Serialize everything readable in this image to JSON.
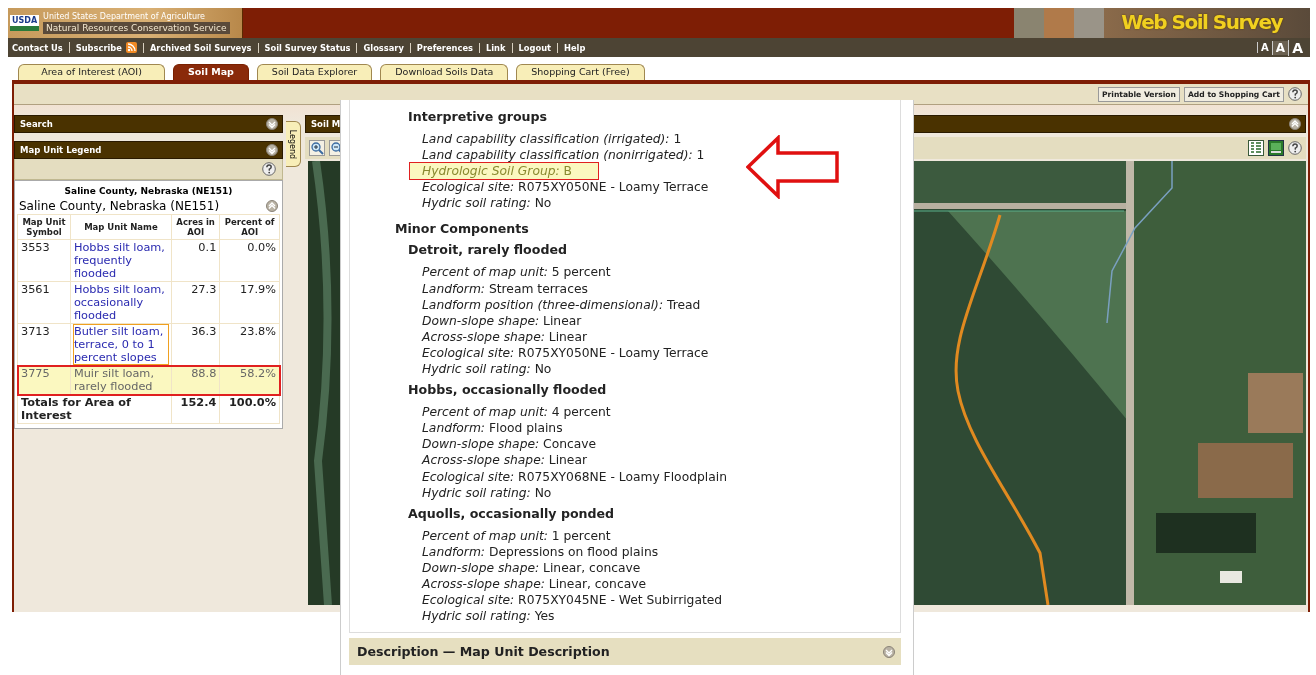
{
  "banner": {
    "logo": "USDA",
    "agency": "United States Department of Agriculture",
    "service": "Natural Resources Conservation Service",
    "site_title": "Web Soil Survey"
  },
  "nav": {
    "links": [
      {
        "label": "Contact Us",
        "kind": "link"
      },
      {
        "label": "Subscribe",
        "kind": "feed"
      },
      {
        "label": "Archived Soil Surveys",
        "kind": "link"
      },
      {
        "label": "Soil Survey Status",
        "kind": "link"
      },
      {
        "label": "Glossary",
        "kind": "link"
      },
      {
        "label": "Preferences",
        "kind": "link"
      },
      {
        "label": "Link",
        "kind": "link"
      },
      {
        "label": "Logout",
        "kind": "link"
      },
      {
        "label": "Help",
        "kind": "link"
      }
    ],
    "font_size_buttons": [
      "A",
      "A",
      "A"
    ]
  },
  "tabs": [
    {
      "label": "Area of Interest (AOI)",
      "selected": false
    },
    {
      "label": "Soil Map",
      "selected": true
    },
    {
      "label": "Soil Data Explorer",
      "selected": false
    },
    {
      "label": "Download Soils Data",
      "selected": false
    },
    {
      "label": "Shopping Cart (Free)",
      "selected": false
    }
  ],
  "toolbar": {
    "buttons": [
      "Printable Version",
      "Add to Shopping Cart"
    ]
  },
  "search_panel": {
    "title": "Search"
  },
  "legend_panel": {
    "title": "Map Unit Legend",
    "area_heading": "Saline County, Nebraska (NE151)",
    "area": "Saline County, Nebraska (NE151)",
    "columns": [
      "Map Unit Symbol",
      "Map Unit Name",
      "Acres in AOI",
      "Percent of AOI"
    ],
    "rows": [
      {
        "symbol": "3553",
        "name": "Hobbs silt loam, frequently flooded",
        "acres": "0.1",
        "percent": "0.0%",
        "selected": false,
        "hovered": false
      },
      {
        "symbol": "3561",
        "name": "Hobbs silt loam, occasionally flooded",
        "acres": "27.3",
        "percent": "17.9%",
        "selected": false,
        "hovered": false
      },
      {
        "symbol": "3713",
        "name": "Butler silt loam, terrace, 0 to 1 percent slopes",
        "acres": "36.3",
        "percent": "23.8%",
        "selected": false,
        "hovered": true
      },
      {
        "symbol": "3775",
        "name": "Muir silt loam, rarely flooded",
        "acres": "88.8",
        "percent": "58.2%",
        "selected": true,
        "hovered": false
      }
    ],
    "totals": {
      "label": "Totals for Area of Interest",
      "acres": "152.4",
      "percent": "100.0%"
    }
  },
  "legend_tab": {
    "label": "Legend"
  },
  "map_panel": {
    "title": "Soil M"
  },
  "popup": {
    "items": [
      {
        "kind": "heading",
        "text": "Interpretive groups"
      },
      {
        "kind": "property",
        "label": "Land capability classification (irrigated):",
        "value": "1",
        "highlighted": false
      },
      {
        "kind": "property",
        "label": "Land capability classification (nonirrigated):",
        "value": "1",
        "highlighted": false
      },
      {
        "kind": "property",
        "label": "Hydrologic Soil Group:",
        "value": "B",
        "highlighted": true
      },
      {
        "kind": "property",
        "label": "Ecological site:",
        "value": "R075XY050NE - Loamy Terrace",
        "highlighted": false
      },
      {
        "kind": "property",
        "label": "Hydric soil rating:",
        "value": "No",
        "highlighted": false
      },
      {
        "kind": "section",
        "text": "Minor Components"
      },
      {
        "kind": "heading",
        "text": "Detroit, rarely flooded"
      },
      {
        "kind": "property",
        "label": "Percent of map unit:",
        "value": "5 percent",
        "highlighted": false
      },
      {
        "kind": "property",
        "label": "Landform:",
        "value": "Stream terraces",
        "highlighted": false
      },
      {
        "kind": "property",
        "label": "Landform position (three-dimensional):",
        "value": "Tread",
        "highlighted": false
      },
      {
        "kind": "property",
        "label": "Down-slope shape:",
        "value": "Linear",
        "highlighted": false
      },
      {
        "kind": "property",
        "label": "Across-slope shape:",
        "value": "Linear",
        "highlighted": false
      },
      {
        "kind": "property",
        "label": "Ecological site:",
        "value": "R075XY050NE - Loamy Terrace",
        "highlighted": false
      },
      {
        "kind": "property",
        "label": "Hydric soil rating:",
        "value": "No",
        "highlighted": false
      },
      {
        "kind": "heading",
        "text": "Hobbs, occasionally flooded"
      },
      {
        "kind": "property",
        "label": "Percent of map unit:",
        "value": "4 percent",
        "highlighted": false
      },
      {
        "kind": "property",
        "label": "Landform:",
        "value": "Flood plains",
        "highlighted": false
      },
      {
        "kind": "property",
        "label": "Down-slope shape:",
        "value": "Concave",
        "highlighted": false
      },
      {
        "kind": "property",
        "label": "Across-slope shape:",
        "value": "Linear",
        "highlighted": false
      },
      {
        "kind": "property",
        "label": "Ecological site:",
        "value": "R075XY068NE - Loamy Floodplain",
        "highlighted": false
      },
      {
        "kind": "property",
        "label": "Hydric soil rating:",
        "value": "No",
        "highlighted": false
      },
      {
        "kind": "heading",
        "text": "Aquolls, occasionally ponded"
      },
      {
        "kind": "property",
        "label": "Percent of map unit:",
        "value": "1 percent",
        "highlighted": false
      },
      {
        "kind": "property",
        "label": "Landform:",
        "value": "Depressions on flood plains",
        "highlighted": false
      },
      {
        "kind": "property",
        "label": "Down-slope shape:",
        "value": "Linear, concave",
        "highlighted": false
      },
      {
        "kind": "property",
        "label": "Across-slope shape:",
        "value": "Linear, concave",
        "highlighted": false
      },
      {
        "kind": "property",
        "label": "Ecological site:",
        "value": "R075XY045NE - Wet Subirrigated",
        "highlighted": false
      },
      {
        "kind": "property",
        "label": "Hydric soil rating:",
        "value": "Yes",
        "highlighted": false
      }
    ],
    "footer": "Description — Map Unit Description"
  }
}
